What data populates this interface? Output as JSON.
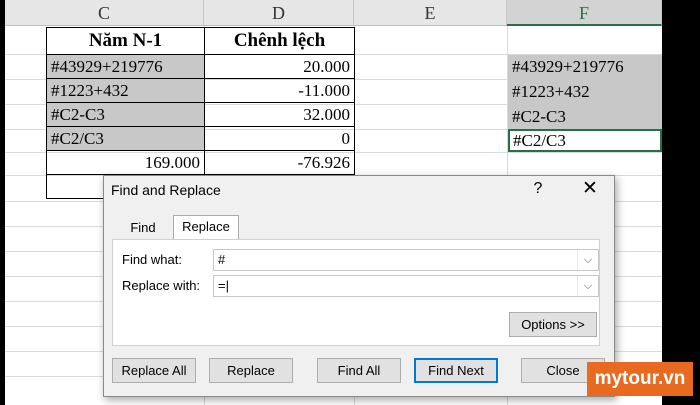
{
  "sheet": {
    "columns": [
      "C",
      "D",
      "E",
      "F"
    ],
    "selected_column": "F",
    "c": [
      "Năm N-1",
      "#43929+219776",
      "#1223+432",
      "#C2-C3",
      "#C2/C3",
      "169.000"
    ],
    "d": [
      "Chênh lệch",
      "20.000",
      "-11.000",
      "32.000",
      "0",
      "-76.926"
    ],
    "f": [
      "#43929+219776",
      "#1223+432",
      "#C2-C3",
      "#C2/C3"
    ]
  },
  "dialog": {
    "title": "Find and Replace",
    "help": "?",
    "close": "✕",
    "tabs": {
      "find": "Find",
      "replace": "Replace"
    },
    "find_label": "Find what:",
    "find_value": "#",
    "replace_label": "Replace with:",
    "replace_value": "=|",
    "options": "Options >>",
    "buttons": {
      "replace_all": "Replace All",
      "replace": "Replace",
      "find_all": "Find All",
      "find_next": "Find Next",
      "close": "Close"
    },
    "dropdown_icon": "⌵"
  },
  "watermark": "mytour.vn",
  "colors": {
    "accent": "#217346",
    "focus": "#0078d7",
    "watermark_bg": "#e86a21"
  }
}
